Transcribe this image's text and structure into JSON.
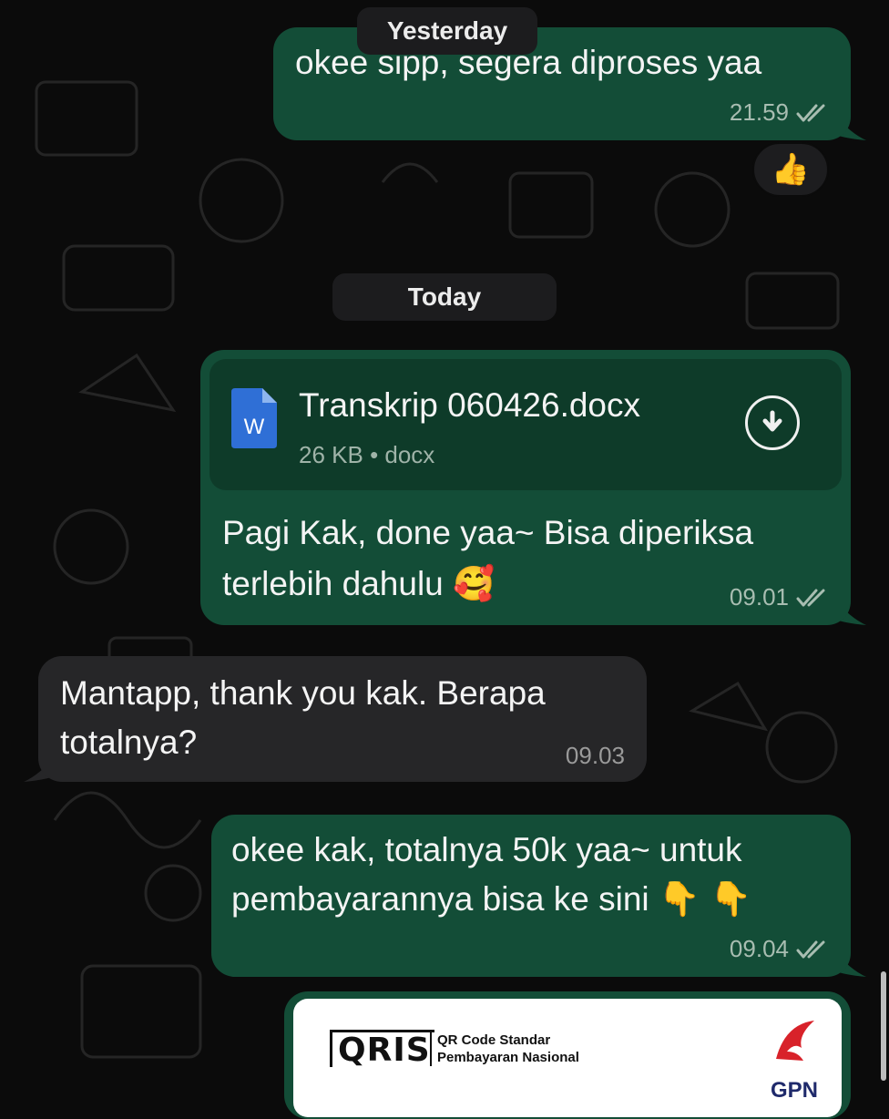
{
  "chat": {
    "date_yesterday": "Yesterday",
    "date_today": "Today",
    "messages": [
      {
        "text": "okee sipp, segera diproses yaa",
        "time": "21.59"
      },
      {
        "file_name": "Transkrip 060426.docx",
        "file_size": "26 KB",
        "file_type": "docx",
        "file_icon_letter": "W",
        "lines": [
          "Pagi Kak, done yaa~ Bisa diperiksa",
          "terlebih dahulu 🥰"
        ],
        "time": "09.01"
      },
      {
        "lines": [
          "Mantapp, thank you kak. Berapa",
          "totalnya?"
        ],
        "time": "09.03"
      },
      {
        "lines": [
          "okee kak, totalnya 50k yaa~ untuk",
          "pembayarannya bisa ke sini 👇 👇"
        ],
        "time": "09.04"
      }
    ],
    "reaction": "👍",
    "qris": {
      "logo": "QRIS",
      "line1": "QR Code Standar",
      "line2": "Pembayaran Nasional",
      "gpn": "GPN"
    }
  },
  "colors": {
    "outgoing": "#134d37",
    "incoming": "#262628",
    "background": "#0b0b0b"
  },
  "icons": [
    "double-check-icon",
    "download-icon",
    "word-document-icon",
    "thumbs-up-emoji"
  ]
}
